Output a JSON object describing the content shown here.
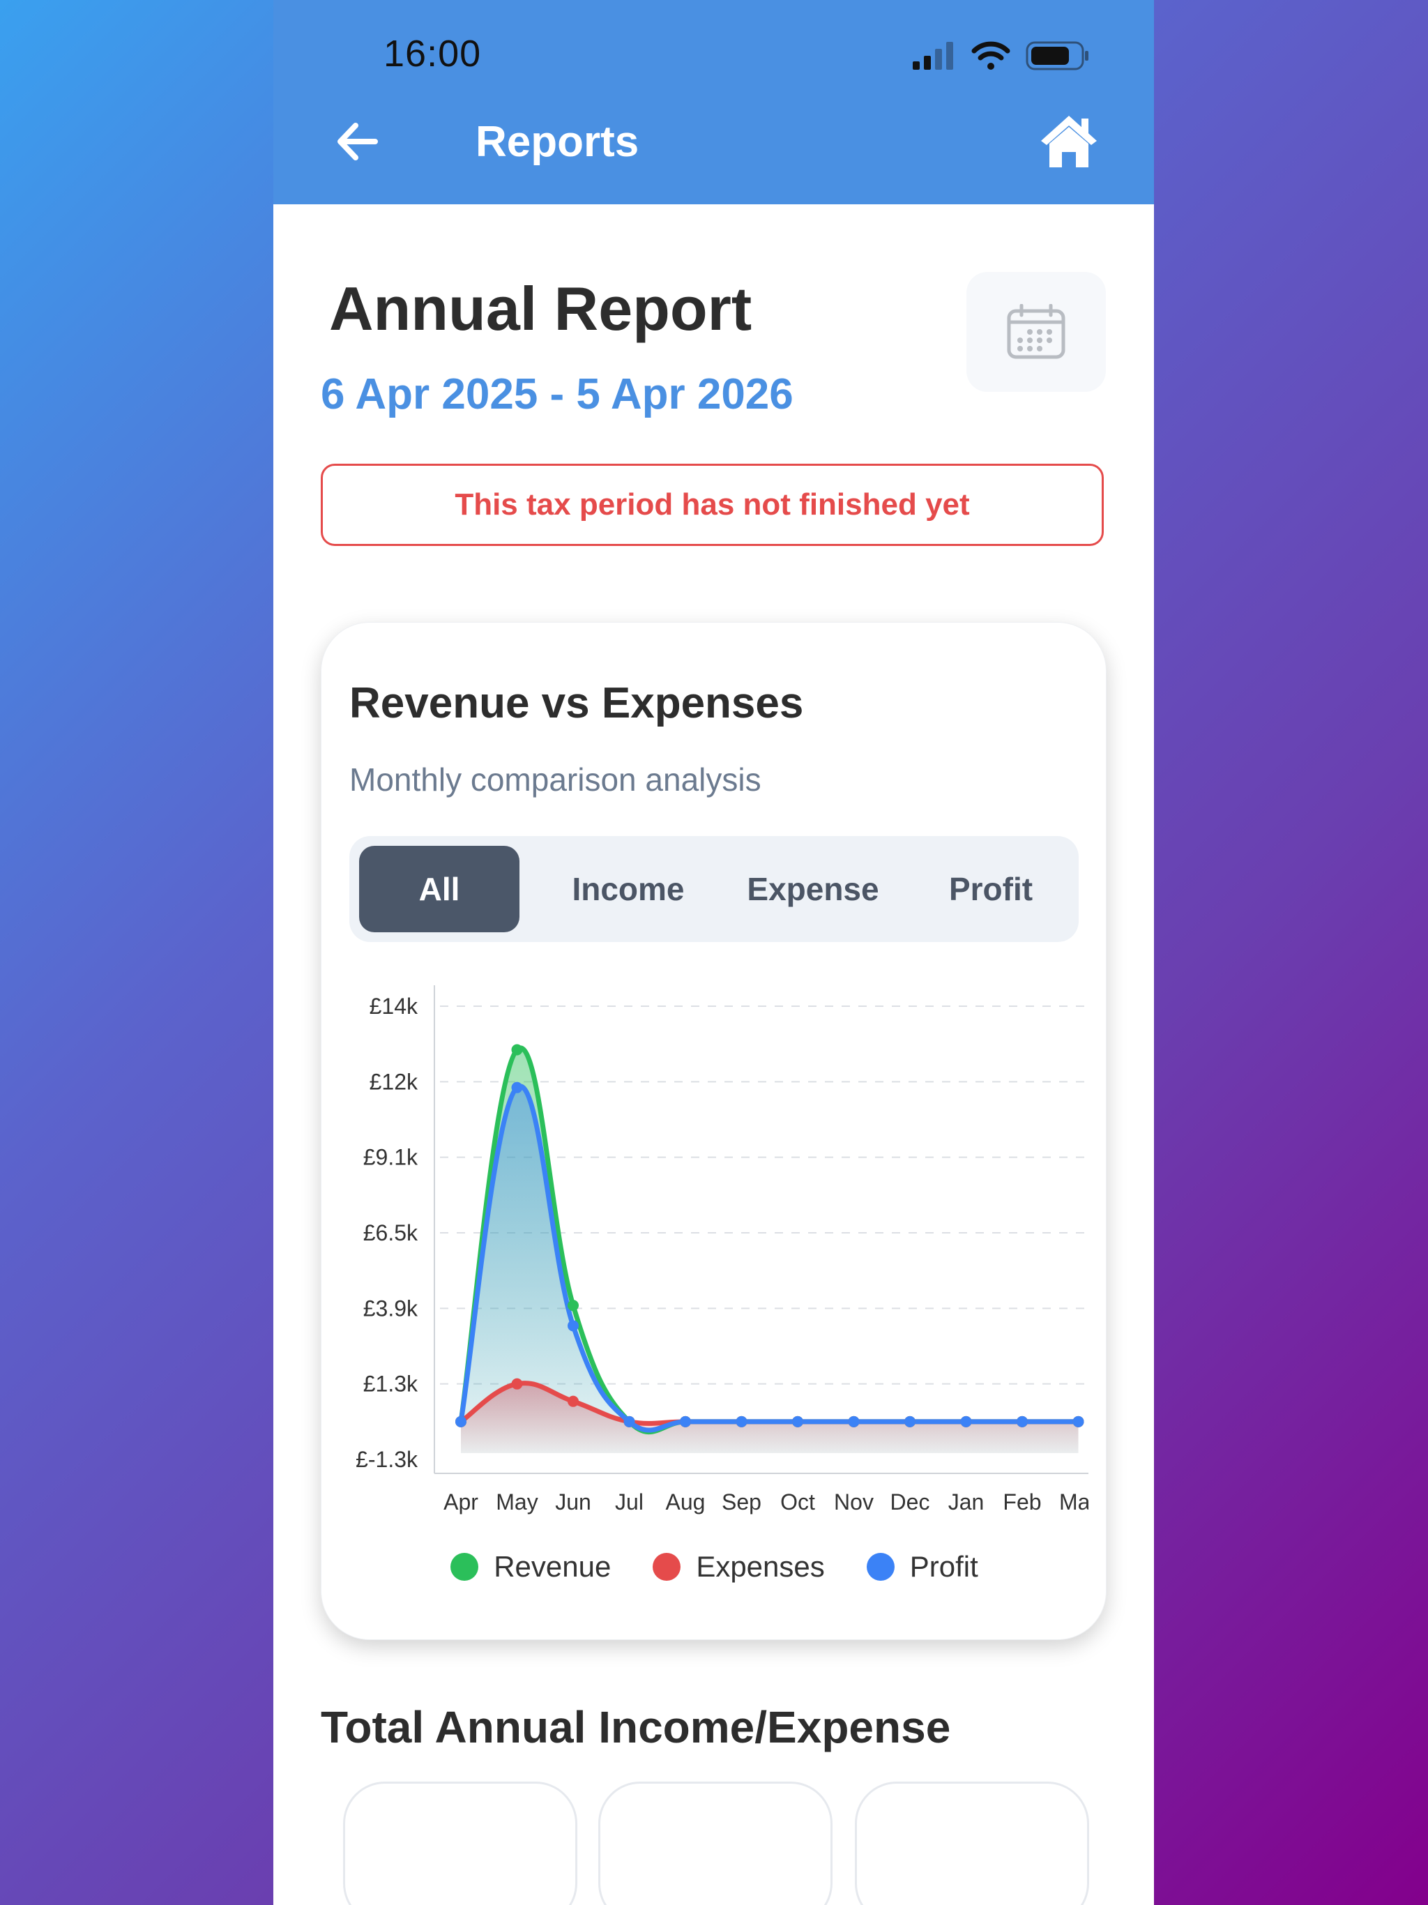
{
  "status_bar": {
    "time": "16:00"
  },
  "nav": {
    "title": "Reports"
  },
  "report": {
    "title": "Annual Report",
    "period": "6 Apr 2025 - 5 Apr 2026",
    "warning": "This tax period has not finished yet"
  },
  "card": {
    "title": "Revenue vs Expenses",
    "subtitle": "Monthly comparison analysis",
    "tabs": [
      {
        "label": "All",
        "active": true
      },
      {
        "label": "Income",
        "active": false
      },
      {
        "label": "Expense",
        "active": false
      },
      {
        "label": "Profit",
        "active": false
      }
    ]
  },
  "colors": {
    "revenue": "#2bbf5a",
    "expenses": "#e54b4b",
    "profit": "#3b82f6",
    "accent": "#4a90e2"
  },
  "chart_data": {
    "type": "area",
    "categories": [
      "Apr",
      "May",
      "Jun",
      "Jul",
      "Aug",
      "Sep",
      "Oct",
      "Nov",
      "Dec",
      "Jan",
      "Feb",
      "Mar"
    ],
    "y_ticks": [
      "£14k",
      "£12k",
      "£9.1k",
      "£6.5k",
      "£3.9k",
      "£1.3k",
      "£-1.3k"
    ],
    "ylim": [
      -1300,
      14300
    ],
    "grid": true,
    "legend_position": "bottom",
    "series": [
      {
        "name": "Revenue",
        "values": [
          0,
          12800,
          4000,
          0,
          0,
          0,
          0,
          0,
          0,
          0,
          0,
          0
        ]
      },
      {
        "name": "Expenses",
        "values": [
          0,
          1300,
          700,
          0,
          0,
          0,
          0,
          0,
          0,
          0,
          0,
          0
        ]
      },
      {
        "name": "Profit",
        "values": [
          0,
          11500,
          3300,
          0,
          0,
          0,
          0,
          0,
          0,
          0,
          0,
          0
        ]
      }
    ]
  },
  "section": {
    "title": "Total Annual Income/Expense"
  }
}
